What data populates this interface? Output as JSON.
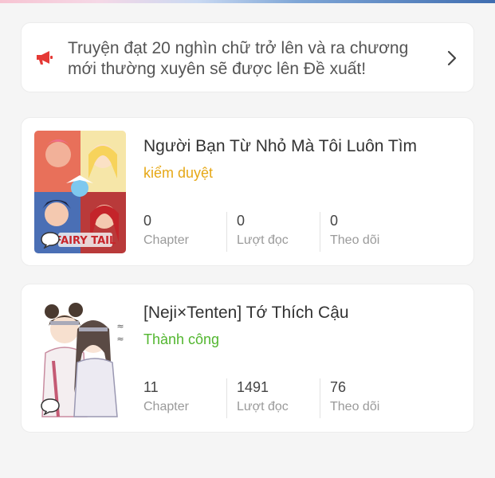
{
  "colors": {
    "review_status": "#e6a817",
    "success_status": "#52b62f",
    "megaphone": "#e53935"
  },
  "notice": {
    "icon": "megaphone-icon",
    "text": "Truyện đạt 20 nghìn chữ trở lên và ra chương mới thường xuyên sẽ được lên Đề xuất!",
    "chevron": "chevron-right-icon"
  },
  "stories": [
    {
      "title": "Người Bạn Từ Nhỏ Mà Tôi Luôn Tìm",
      "status": "kiểm duyệt",
      "chapters": "0",
      "chapters_label": "Chapter",
      "reads": "0",
      "reads_label": "Lượt đọc",
      "follows": "0",
      "follows_label": "Theo dõi"
    },
    {
      "title": "[Neji×Tenten] Tớ Thích Cậu",
      "status": "Thành công",
      "chapters": "11",
      "chapters_label": "Chapter",
      "reads": "1491",
      "reads_label": "Lượt đọc",
      "follows": "76",
      "follows_label": "Theo dõi"
    }
  ]
}
